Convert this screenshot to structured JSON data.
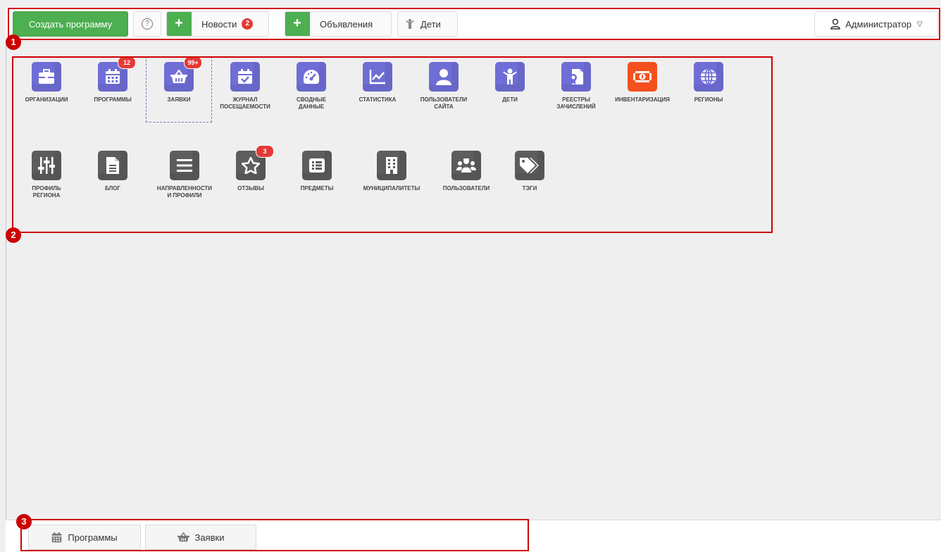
{
  "topbar": {
    "create_label": "Создать программу",
    "help_icon": "question-circle-icon",
    "news_label": "Новости",
    "news_badge": "2",
    "ads_label": "Объявления",
    "kids_label": "Дети",
    "admin_label": "Администратор"
  },
  "tiles": [
    {
      "label": "ОРГАНИЗАЦИИ",
      "icon": "briefcase-icon",
      "color": "#6f6ed6"
    },
    {
      "label": "ПРОГРАММЫ",
      "icon": "calendar-icon",
      "color": "#6f6ed6",
      "badge": "12"
    },
    {
      "label": "ЗАЯВКИ",
      "icon": "basket-icon",
      "color": "#6f6ed6",
      "badge": "99+"
    },
    {
      "label": "ЖУРНАЛ\nПОСЕЩАЕМОСТИ",
      "icon": "calendar-check-icon",
      "color": "#6f6ed6"
    },
    {
      "label": "СВОДНЫЕ\nДАННЫЕ",
      "icon": "gauge-icon",
      "color": "#6f6ed6"
    },
    {
      "label": "СТАТИСТИКА",
      "icon": "chart-line-icon",
      "color": "#6f6ed6"
    },
    {
      "label": "ПОЛЬЗОВАТЕЛИ\nСАЙТА",
      "icon": "user-icon",
      "color": "#6f6ed6"
    },
    {
      "label": "ДЕТИ",
      "icon": "child-icon",
      "color": "#6f6ed6"
    },
    {
      "label": "РЕЕСТРЫ\nЗАЧИСЛЕНИЙ",
      "icon": "certificate-icon",
      "color": "#6f6ed6"
    },
    {
      "label": "ИНВЕНТАРИЗАЦИЯ",
      "icon": "money-bill-icon",
      "color": "#f4511e"
    },
    {
      "label": "РЕГИОНЫ",
      "icon": "globe-icon",
      "color": "#6f6ed6"
    },
    {
      "label": "ПРОФИЛЬ\nРЕГИОНА",
      "icon": "sliders-icon",
      "color": "#5d5d5d"
    },
    {
      "label": "БЛОГ",
      "icon": "file-text-icon",
      "color": "#5d5d5d"
    },
    {
      "label": "НАПРАВЛЕННОСТИ\nИ ПРОФИЛИ",
      "icon": "list-lines-icon",
      "color": "#5d5d5d"
    },
    {
      "label": "ОТЗЫВЫ",
      "icon": "star-icon",
      "color": "#5d5d5d",
      "badge": "3"
    },
    {
      "label": "ПРЕДМЕТЫ",
      "icon": "list-alt-icon",
      "color": "#5d5d5d"
    },
    {
      "label": "МУНИЦИПАЛИТЕТЫ",
      "icon": "building-icon",
      "color": "#5d5d5d"
    },
    {
      "label": "ПОЛЬЗОВАТЕЛИ",
      "icon": "users-icon",
      "color": "#5d5d5d"
    },
    {
      "label": "ТЭГИ",
      "icon": "tags-icon",
      "color": "#5d5d5d"
    }
  ],
  "bottombar": {
    "tabs": [
      {
        "label": "Программы",
        "icon": "calendar-icon"
      },
      {
        "label": "Заявки",
        "icon": "basket-icon"
      }
    ]
  },
  "annotations": [
    "1",
    "2",
    "3"
  ]
}
